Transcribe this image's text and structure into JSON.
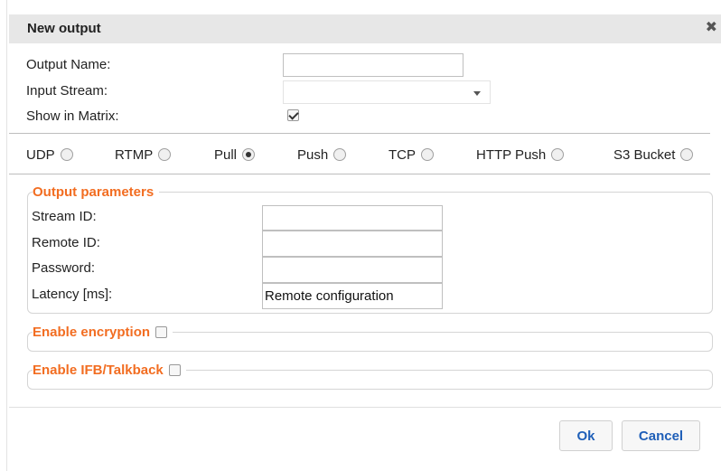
{
  "dialog": {
    "title": "New output",
    "close_glyph": "✖"
  },
  "form": {
    "output_name": {
      "label": "Output Name:",
      "value": ""
    },
    "input_stream": {
      "label": "Input Stream:",
      "value": ""
    },
    "show_in_matrix": {
      "label": "Show in Matrix:",
      "checked": true
    }
  },
  "protocols": [
    {
      "label": "UDP",
      "selected": false
    },
    {
      "label": "RTMP",
      "selected": false
    },
    {
      "label": "Pull",
      "selected": true
    },
    {
      "label": "Push",
      "selected": false
    },
    {
      "label": "TCP",
      "selected": false
    },
    {
      "label": "HTTP Push",
      "selected": false
    },
    {
      "label": "S3 Bucket",
      "selected": false
    }
  ],
  "output_parameters": {
    "legend": "Output parameters",
    "stream_id": {
      "label": "Stream ID:",
      "value": ""
    },
    "remote_id": {
      "label": "Remote ID:",
      "value": ""
    },
    "password": {
      "label": "Password:",
      "value": ""
    },
    "latency": {
      "label": "Latency [ms]:",
      "value": "Remote configuration"
    }
  },
  "enable_encryption": {
    "legend": "Enable encryption",
    "checked": false
  },
  "enable_ifb": {
    "legend": "Enable IFB/Talkback",
    "checked": false
  },
  "buttons": {
    "ok": "Ok",
    "cancel": "Cancel"
  },
  "colors": {
    "accent": "#f26d21",
    "button_text": "#1f5fb8",
    "titlebar": "#e7e7e7"
  }
}
